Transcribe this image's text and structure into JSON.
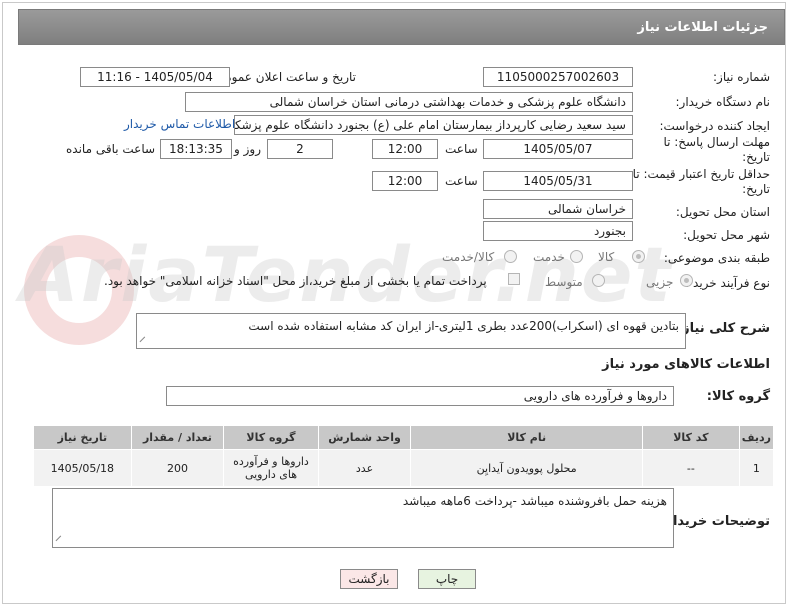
{
  "header": {
    "title": "جزئیات اطلاعات نیاز"
  },
  "watermark": {
    "text": "AriaTender.net"
  },
  "fields": {
    "need_number_label": "شماره نیاز:",
    "need_number": "1105000257002603",
    "announce_label": "تاریخ و ساعت اعلان عمومی:",
    "announce_value": "1405/05/04 - 11:16",
    "buyer_org_label": "نام دستگاه خریدار:",
    "buyer_org": "دانشگاه علوم پزشکی و خدمات بهداشتی درمانی استان خراسان شمالی",
    "creator_label": "ایجاد کننده درخواست:",
    "creator": "سید سعید رضایی کارپرداز بیمارستان امام علی (ع) بجنورد دانشگاه علوم پزشکی",
    "contact_link": "اطلاعات تماس خریدار",
    "reply_deadline_label": "مهلت ارسال پاسخ: تا تاریخ:",
    "reply_date": "1405/05/07",
    "time_label": "ساعت",
    "reply_time": "12:00",
    "days_value": "2",
    "days_label": "روز و",
    "remaining_time": "18:13:35",
    "remaining_label": "ساعت باقی مانده",
    "validity_label": "حداقل تاریخ اعتبار قیمت: تا تاریخ:",
    "validity_date": "1405/05/31",
    "validity_time": "12:00",
    "province_label": "استان محل تحویل:",
    "province": "خراسان شمالی",
    "city_label": "شهر محل تحویل:",
    "city": "بجنورد",
    "category_label": "طبقه بندی موضوعی:",
    "category_options": [
      "کالا",
      "خدمت",
      "کالا/خدمت"
    ],
    "process_label": "نوع فرآیند خرید :",
    "process_options": [
      "جزیی",
      "متوسط"
    ],
    "payment_note": "پرداخت تمام یا بخشی از مبلغ خرید،از محل \"اسناد خزانه اسلامی\" خواهد بود.",
    "description_label": "شرح کلی نیاز:",
    "description": "بتادین قهوه ای (اسکراب)200عدد بطری  1لیتری-از ایران کد مشابه استفاده شده است",
    "goods_info_title": "اطلاعات کالاهای مورد نیاز",
    "goods_group_label": "گروه کالا:",
    "goods_group": "داروها و فرآورده های دارویی",
    "buyer_notes_label": "توضیحات خریدار:",
    "buyer_notes": "هزینه حمل بافروشنده میباشد -پرداخت 6ماهه میباشد"
  },
  "table": {
    "headers": [
      "ردیف",
      "کد کالا",
      "نام کالا",
      "واحد شمارش",
      "گروه کالا",
      "تعداد / مقدار",
      "تاریخ نیاز"
    ],
    "rows": [
      [
        "1",
        "--",
        "محلول پوویدون آیدایِن",
        "عدد",
        "داروها و فرآورده های دارویی",
        "200",
        "1405/05/18"
      ]
    ]
  },
  "buttons": {
    "print": "چاپ",
    "back": "بازگشت"
  }
}
